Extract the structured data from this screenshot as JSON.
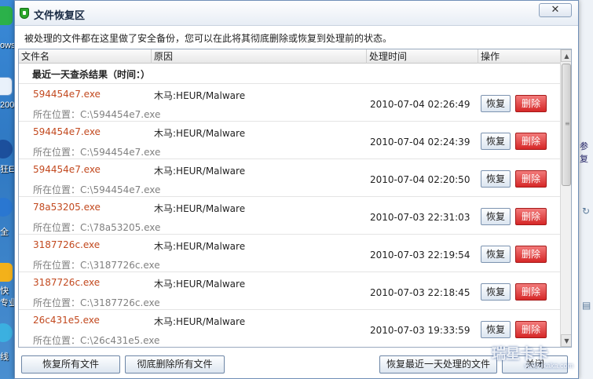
{
  "desktop": {
    "labels": [
      "ows",
      "200",
      "狂E",
      "全",
      "快",
      "专业",
      "线"
    ],
    "right_label": "参复"
  },
  "dialog": {
    "title": "文件恢复区",
    "close": "✕",
    "description": "被处理的文件都在这里做了安全备份，您可以在此将其彻底删除或恢复到处理前的状态。"
  },
  "columns": {
    "name": "文件名",
    "reason": "原因",
    "time": "处理时间",
    "action": "操作"
  },
  "group_title": "最近一天查杀结果（时间：）",
  "rows": [
    {
      "name": "594454e7.exe",
      "location": "所在位置：C:\\594454e7.exe",
      "reason": "木马:HEUR/Malware",
      "time": "2010-07-04 02:26:49"
    },
    {
      "name": "594454e7.exe",
      "location": "所在位置：C:\\594454e7.exe",
      "reason": "木马:HEUR/Malware",
      "time": "2010-07-04 02:24:39"
    },
    {
      "name": "594454e7.exe",
      "location": "所在位置：C:\\594454e7.exe",
      "reason": "木马:HEUR/Malware",
      "time": "2010-07-04 02:20:50"
    },
    {
      "name": "78a53205.exe",
      "location": "所在位置：C:\\78a53205.exe",
      "reason": "木马:HEUR/Malware",
      "time": "2010-07-03 22:31:03"
    },
    {
      "name": "3187726c.exe",
      "location": "所在位置：C:\\3187726c.exe",
      "reason": "木马:HEUR/Malware",
      "time": "2010-07-03 22:19:54"
    },
    {
      "name": "3187726c.exe",
      "location": "所在位置：C:\\3187726c.exe",
      "reason": "木马:HEUR/Malware",
      "time": "2010-07-03 22:18:45"
    },
    {
      "name": "26c431e5.exe",
      "location": "所在位置：C:\\26c431e5.exe",
      "reason": "木马:HEUR/Malware",
      "time": "2010-07-03 19:33:59"
    }
  ],
  "row_actions": {
    "restore": "恢复",
    "delete": "删除"
  },
  "footer": {
    "restore_all": "恢复所有文件",
    "delete_all": "彻底删除所有文件",
    "restore_recent": "恢复最近一天处理的文件",
    "close": "关闭"
  },
  "watermark": {
    "text": "瑞星卡卡",
    "sub": "www.ikaka.com"
  },
  "colors": {
    "file_name": "#c2491f",
    "location": "#808080",
    "delete_button": "#d62828",
    "desktop_blue": "#3a7fc6"
  }
}
